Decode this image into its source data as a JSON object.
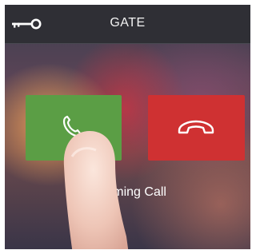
{
  "header": {
    "title": "GATE",
    "icon": "key-icon"
  },
  "buttons": {
    "answer": {
      "icon": "phone-icon",
      "color": "#5b9e45"
    },
    "decline": {
      "icon": "hang-up-icon",
      "color": "#cf3132"
    }
  },
  "status": {
    "text": "Incoming Call"
  }
}
